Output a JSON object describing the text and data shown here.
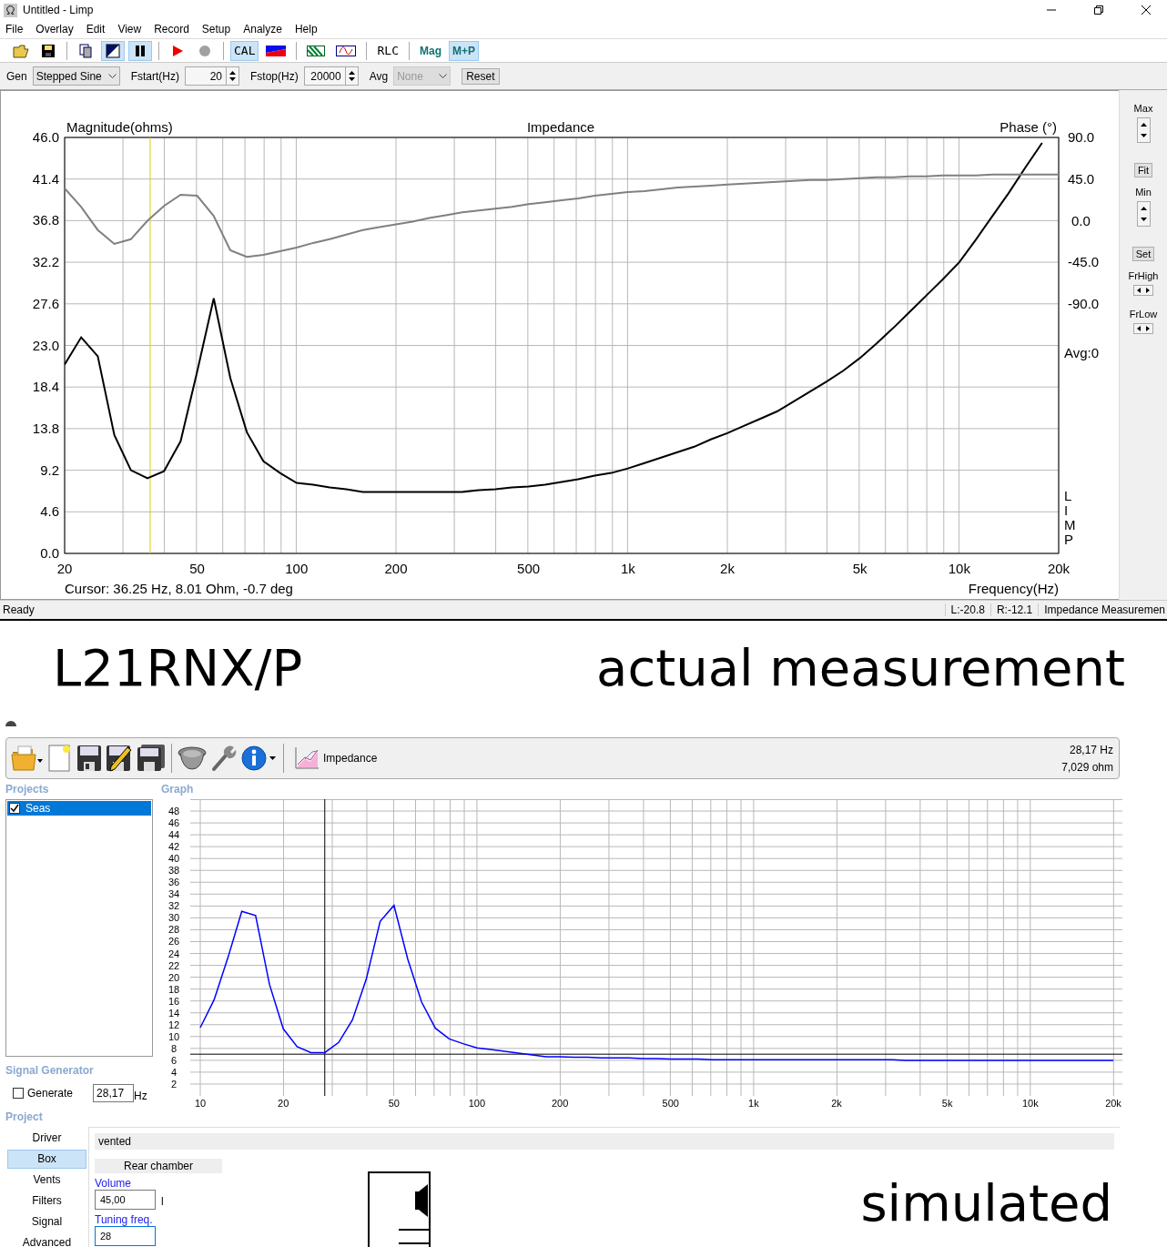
{
  "limp": {
    "window": {
      "title": "Untitled - Limp"
    },
    "menu": [
      "File",
      "Overlay",
      "Edit",
      "View",
      "Record",
      "Setup",
      "Analyze",
      "Help"
    ],
    "toolbar": [
      {
        "kind": "icon",
        "selected": false
      },
      {
        "kind": "icon",
        "selected": false
      },
      {
        "kind": "sep"
      },
      {
        "kind": "icon",
        "selected": false
      },
      {
        "kind": "icon",
        "selected": true
      },
      {
        "kind": "icon",
        "selected": true
      },
      {
        "kind": "sep"
      },
      {
        "kind": "icon",
        "selected": false
      },
      {
        "kind": "icon",
        "selected": false
      },
      {
        "kind": "sep"
      },
      {
        "kind": "text",
        "label": "CAL",
        "selected": true
      },
      {
        "kind": "icon",
        "selected": false
      },
      {
        "kind": "sep"
      },
      {
        "kind": "icon",
        "selected": false
      },
      {
        "kind": "icon",
        "selected": false
      },
      {
        "kind": "sep"
      },
      {
        "kind": "text",
        "label": "RLC",
        "selected": false
      },
      {
        "kind": "sep"
      },
      {
        "kind": "text",
        "label": "Mag",
        "selected": false
      },
      {
        "kind": "text",
        "label": "M+P",
        "selected": true
      }
    ],
    "generator": {
      "gen_label": "Gen",
      "gen_value": "Stepped Sine",
      "fstart_label": "Fstart(Hz)",
      "fstart_value": "20",
      "fstop_label": "Fstop(Hz)",
      "fstop_value": "20000",
      "avg_label": "Avg",
      "avg_value": "None",
      "avg_disabled": true,
      "reset_button": "Reset"
    },
    "graph": {
      "avg_text": "Avg:0",
      "logo": "LIMP",
      "cursor_text": "Cursor: 36.25 Hz, 8.01 Ohm, -0.7 deg",
      "chart_data": {
        "type": "line",
        "title": "Impedance",
        "xlabel": "Frequency(Hz)",
        "ylabel": "Magnitude(ohms)",
        "categories": [
          "20",
          null,
          null,
          null,
          null,
          null,
          null,
          null,
          "50",
          null,
          null,
          null,
          null,
          null,
          "100",
          null,
          null,
          null,
          null,
          null,
          "200",
          null,
          null,
          null,
          null,
          null,
          null,
          null,
          "500",
          null,
          null,
          null,
          null,
          null,
          "1k",
          null,
          null,
          null,
          null,
          null,
          "2k",
          null,
          null,
          null,
          null,
          null,
          null,
          null,
          "5k",
          null,
          null,
          null,
          null,
          null,
          "10k",
          null,
          null,
          null,
          null,
          null,
          "20k"
        ],
        "series": [
          {
            "color": "#000000",
            "values": [
              20.9,
              23.9,
              21.8,
              13.1,
              9.2,
              8.3,
              9.1,
              12.4,
              20.1,
              28.2,
              19.4,
              13.4,
              10.2,
              8.9,
              7.8,
              7.6,
              7.3,
              7.1,
              6.8,
              6.8,
              6.8,
              6.8,
              6.8,
              6.8,
              6.8,
              7.0,
              7.1,
              7.3,
              7.4,
              7.6,
              7.9,
              8.2,
              8.6,
              8.9,
              9.4,
              10.0,
              10.6,
              11.2,
              11.8,
              12.6,
              13.3,
              14.1,
              14.9,
              15.7,
              16.8,
              17.9,
              19.0,
              20.2,
              21.6,
              23.2,
              24.9,
              26.7,
              28.5,
              30.3,
              32.2,
              34.7,
              37.3,
              39.9,
              42.7,
              45.4,
              null
            ]
          }
        ],
        "ylim": [
          0,
          46
        ],
        "yticks": [
          {
            "value": 0,
            "label": "0.0"
          },
          {
            "value": 4.6,
            "label": "4.6"
          },
          {
            "value": 9.2,
            "label": "9.2"
          },
          {
            "value": 13.8,
            "label": "13.8"
          },
          {
            "value": 18.4,
            "label": "18.4"
          },
          {
            "value": 23,
            "label": "23.0"
          },
          {
            "value": 27.6,
            "label": "27.6"
          },
          {
            "value": 32.2,
            "label": "32.2"
          },
          {
            "value": 36.8,
            "label": "36.8"
          },
          {
            "value": 41.4,
            "label": "41.4"
          },
          {
            "value": 46,
            "label": "46.0"
          }
        ],
        "grid": true
      }
    },
    "phase_axis": {
      "chart_data": {
        "type": "line",
        "ylabel": "Phase (°)",
        "series": [
          {
            "color": "#808080",
            "values": [
              35,
              15,
              -10,
              -25,
              -20,
              0,
              16,
              28,
              27,
              5,
              -32,
              -39,
              -37,
              -33,
              -29,
              -24,
              -20,
              -15,
              -10,
              -7,
              -4,
              -1,
              3,
              6,
              9,
              11,
              13,
              15,
              18,
              20,
              22,
              24,
              27,
              29,
              31,
              32,
              34,
              36,
              37,
              38,
              39,
              40,
              41,
              42,
              43,
              44,
              44,
              45,
              46,
              47,
              47,
              48,
              48,
              49,
              49,
              49,
              50,
              50,
              50,
              50,
              50
            ]
          }
        ],
        "ylim": [
          -90,
          90
        ],
        "yticks": [
          {
            "value": 90,
            "label": "90.0"
          },
          {
            "value": 45,
            "label": "45.0"
          },
          {
            "value": 0,
            "label": "0.0"
          },
          {
            "value": -45,
            "label": "-45.0"
          },
          {
            "value": -90,
            "label": "-90.0"
          }
        ]
      }
    },
    "side_panel": {
      "max_label": "Max",
      "fit_button": "Fit",
      "min_label": "Min",
      "set_button": "Set",
      "frhigh_label": "FrHigh",
      "frlow_label": "FrLow"
    },
    "status_bar": {
      "message": "Ready",
      "left": "L:-20.8",
      "right": "R:-12.1",
      "mode": "Impedance Measuremen"
    }
  },
  "caption_left": "L21RNX/P",
  "caption_right": "actual measurement",
  "winisd": {
    "toolbar": {
      "dropdown": "Impedance",
      "readout_freq": "28,17 Hz",
      "readout_imp": "7,029 ohm"
    },
    "projects": {
      "heading": "Projects",
      "items": [
        {
          "label": "Seas",
          "checked": true,
          "selected": true
        }
      ]
    },
    "graph": {
      "heading": "Graph",
      "chart_data": {
        "type": "line",
        "categories": [
          "10",
          null,
          null,
          null,
          null,
          null,
          "20",
          null,
          null,
          null,
          null,
          null,
          null,
          null,
          "50",
          null,
          null,
          null,
          null,
          null,
          "100",
          null,
          null,
          null,
          null,
          null,
          "200",
          null,
          null,
          null,
          null,
          null,
          null,
          null,
          "500",
          null,
          null,
          null,
          null,
          null,
          "1k",
          null,
          null,
          null,
          null,
          null,
          "2k",
          null,
          null,
          null,
          null,
          null,
          null,
          null,
          "5k",
          null,
          null,
          null,
          null,
          null,
          "10k",
          null,
          null,
          null,
          null,
          null,
          "20k"
        ],
        "series": [
          {
            "color": "#0000ff",
            "values": [
              11.5,
              16.2,
              23.3,
              31.1,
              30.4,
              18.8,
              11.3,
              8.3,
              7.3,
              7.3,
              9.0,
              12.8,
              19.7,
              29.4,
              32.1,
              23.0,
              15.8,
              11.4,
              9.6,
              8.8,
              8.1,
              7.8,
              7.5,
              7.2,
              6.9,
              6.6,
              6.6,
              6.5,
              6.5,
              6.4,
              6.4,
              6.4,
              6.3,
              6.3,
              6.2,
              6.2,
              6.2,
              6.1,
              6.1,
              6.1,
              6.1,
              6.1,
              6.1,
              6.1,
              6.1,
              6.1,
              6.1,
              6.1,
              6.1,
              6.1,
              6.1,
              6.0,
              6.0,
              6.0,
              6.0,
              6.0,
              6.0,
              6.0,
              6.0,
              6.0,
              6.0,
              6.0,
              6.0,
              6.0,
              6.0,
              6.0,
              6.0
            ]
          }
        ],
        "ylim": [
          0,
          50
        ],
        "yticks": [
          2,
          4,
          6,
          8,
          10,
          12,
          14,
          16,
          18,
          20,
          22,
          24,
          26,
          28,
          30,
          32,
          34,
          36,
          38,
          40,
          42,
          44,
          46,
          48
        ],
        "grid": true,
        "ref_lines": [
          {
            "axis": "y",
            "value": 7.029
          }
        ]
      }
    },
    "signal_generator": {
      "heading": "Signal Generator",
      "generate_label": "Generate",
      "generate_checked": false,
      "frequency": "28,17",
      "unit": "Hz"
    },
    "project": {
      "heading": "Project",
      "nav": [
        {
          "label": "Driver",
          "selected": false
        },
        {
          "label": "Box",
          "selected": true
        },
        {
          "label": "Vents",
          "selected": false
        },
        {
          "label": "Filters",
          "selected": false
        },
        {
          "label": "Signal",
          "selected": false
        },
        {
          "label": "Advanced",
          "selected": false
        }
      ],
      "box_type": "vented",
      "section": "Rear chamber",
      "volume_label": "Volume",
      "volume_value": "45,00",
      "volume_unit": "l",
      "tuning_label": "Tuning freq.",
      "tuning_value": "28"
    }
  },
  "caption_bottom": "simulated"
}
